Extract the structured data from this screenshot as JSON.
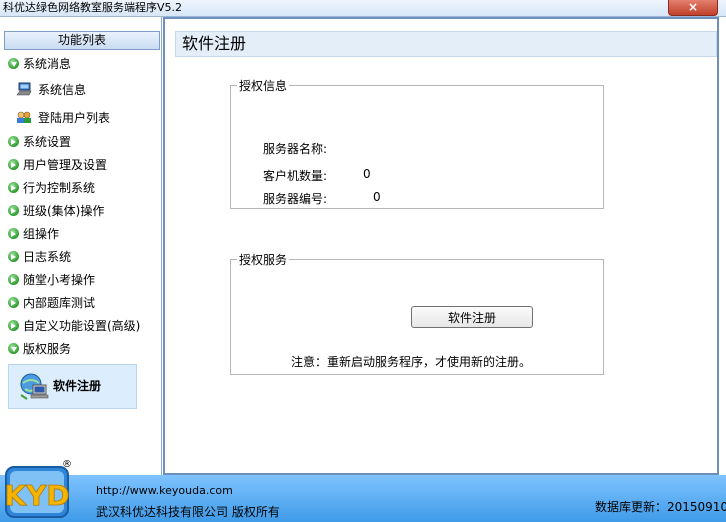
{
  "window": {
    "title": "科优达绿色网络教室服务端程序V5.2",
    "close_symbol": "×"
  },
  "sidebar": {
    "header": "功能列表",
    "groups": [
      {
        "label": "系统消息",
        "expanded": true
      },
      {
        "label": "系统设置"
      },
      {
        "label": "用户管理及设置"
      },
      {
        "label": "行为控制系统"
      },
      {
        "label": "班级(集体)操作"
      },
      {
        "label": "组操作"
      },
      {
        "label": "日志系统"
      },
      {
        "label": "随堂小考操作"
      },
      {
        "label": "内部题库测试"
      },
      {
        "label": "自定义功能设置(高级)"
      },
      {
        "label": "版权服务",
        "expanded": true
      }
    ],
    "sub_items": [
      {
        "label": "系统信息",
        "icon": "computer-icon"
      },
      {
        "label": "登陆用户列表",
        "icon": "users-icon"
      }
    ],
    "selected": {
      "label": "软件注册",
      "icon": "network-computer-icon"
    }
  },
  "main": {
    "title": "软件注册",
    "auth_info": {
      "legend": "授权信息",
      "fields": [
        {
          "label": "服务器名称:",
          "value": ""
        },
        {
          "label": "客户机数量:",
          "value": "0"
        },
        {
          "label": "服务器编号:",
          "value": "0"
        }
      ]
    },
    "auth_service": {
      "legend": "授权服务",
      "button_label": "软件注册",
      "note": "注意：重新启动服务程序，才使用新的注册。"
    }
  },
  "footer": {
    "url": "http://www.keyouda.com",
    "company": "武汉科优达科技有限公司  版权所有",
    "db_update": "数据库更新：20150910",
    "logo_text": "KYD",
    "registered_mark": "®"
  },
  "colors": {
    "footer_blue": "#3f9be8",
    "bullet_green": "#2d9b2d",
    "selected_bg": "#dceefd"
  }
}
